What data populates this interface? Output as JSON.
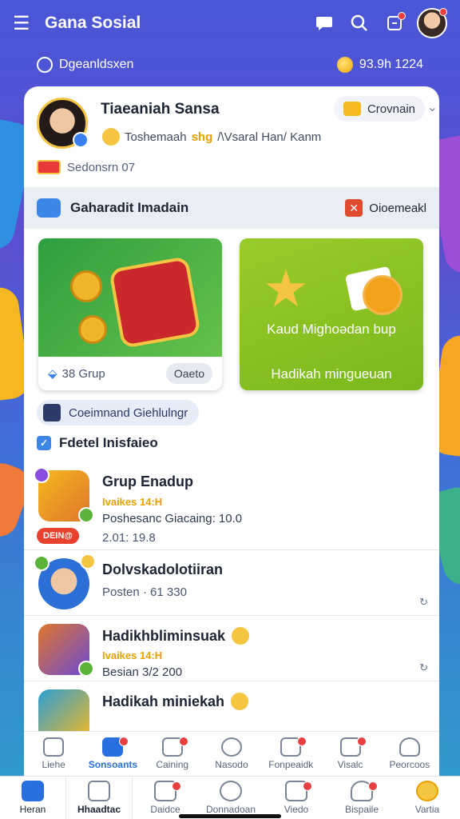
{
  "topbar": {
    "title": "Gana Sosial"
  },
  "subbar": {
    "left": "Dgeanldsxen",
    "right": "93.9h 1224"
  },
  "profile": {
    "name": "Tiaeaniah Sansa",
    "status_pre": "Toshemaah",
    "status_hl": "shg",
    "status_post": "/\\Vsaral Han/ Kanm",
    "location": "Sedonsrn 07",
    "chip": "Crovnain"
  },
  "section": {
    "title": "Gaharadit Imadain",
    "right": "Oioemeakl"
  },
  "tiles": {
    "a": {
      "foot": "38 Grup",
      "button": "Oaeto"
    },
    "b": {
      "line1": "Kaud Mighoədan bup",
      "line2": "Hadikah mingueuan"
    }
  },
  "pill": "Coeimnand Giehlulngr",
  "list_head": "Fdetel Inisfaieo",
  "items": [
    {
      "title": "Grup Enadup",
      "tag": "Ivaikes 14:H",
      "desc": "Poshesanc Giacaing: 10.0",
      "time": "2.01: 19.8",
      "live": "DEIN@"
    },
    {
      "title": "Dolvskadolotiiran",
      "sub": "Posten · 61 330"
    },
    {
      "title": "Hadikhbliminsuak",
      "tag": "Ivaikes 14:H",
      "sub": "Besian 3/2 200"
    },
    {
      "title": "Hadikah miniekah"
    }
  ],
  "inner_tabs": [
    "Liehe",
    "Sonsoants",
    "Caining",
    "Nasodo",
    "Fonpeaidk",
    "Visalc",
    "Peorcoos"
  ],
  "bottom_tabs": [
    "Heran",
    "Hhaadtac",
    "Daidce",
    "Donnadoan",
    "Viedo",
    "Bispaile",
    "Vartia"
  ],
  "colors": {
    "accent": "#2a6fe0",
    "bg_top": "#4a57d6",
    "live": "#e8412e",
    "tag": "#e8a000"
  }
}
